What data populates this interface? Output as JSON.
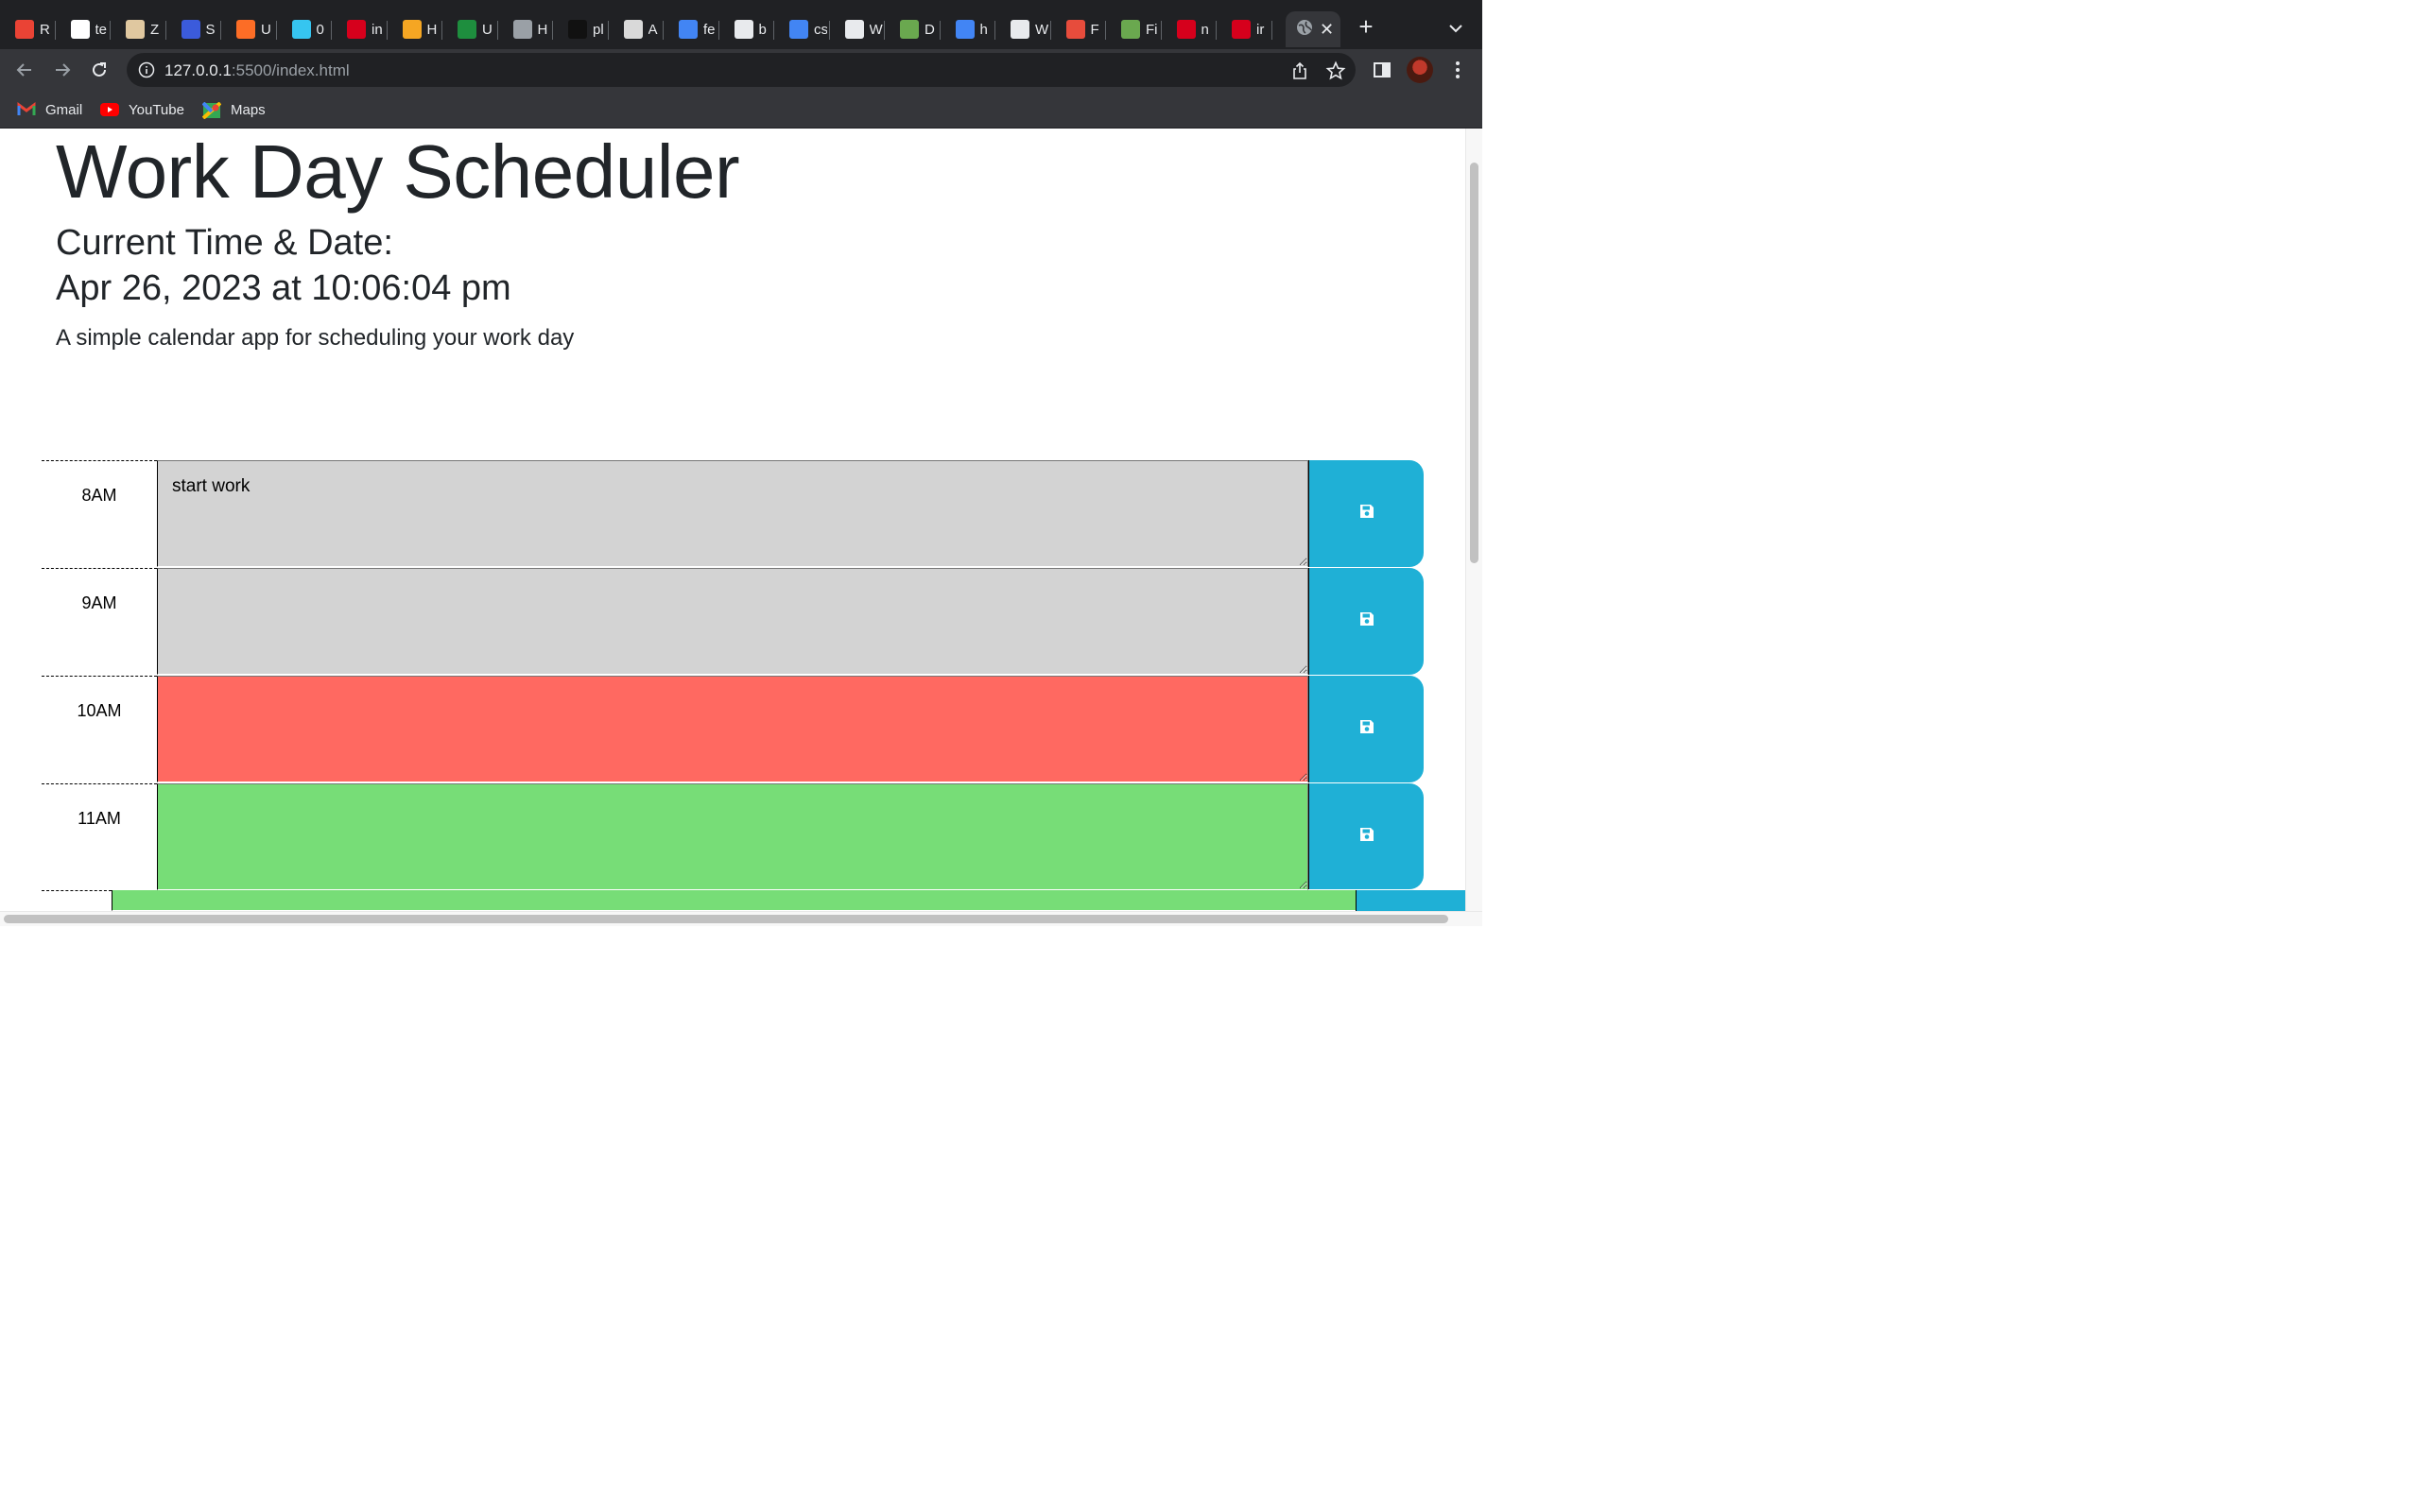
{
  "browser": {
    "tabs": [
      {
        "icon": "gmail-icon",
        "title": "R",
        "color": "#ea4335"
      },
      {
        "icon": "github-icon",
        "title": "te",
        "color": "#ffffff"
      },
      {
        "icon": "zoom-icon",
        "title": "Z",
        "color": "#e0c8a0"
      },
      {
        "icon": "rocket-icon",
        "title": "S",
        "color": "#3b5bdb"
      },
      {
        "icon": "gitlab-icon",
        "title": "U",
        "color": "#fc6d26"
      },
      {
        "icon": "slack-icon",
        "title": "0",
        "color": "#36c5f0"
      },
      {
        "icon": "n-icon",
        "title": "in",
        "color": "#d6001c"
      },
      {
        "icon": "fs-icon",
        "title": "H",
        "color": "#f5a623"
      },
      {
        "icon": "plus-green-icon",
        "title": "U",
        "color": "#1e8e3e"
      },
      {
        "icon": "s-letter-icon",
        "title": "H",
        "color": "#9aa0a6"
      },
      {
        "icon": "block-icon",
        "title": "pl",
        "color": "#111111"
      },
      {
        "icon": "bird-icon",
        "title": "A",
        "color": "#d9d9d9"
      },
      {
        "icon": "google-icon",
        "title": "fe",
        "color": "#4285f4"
      },
      {
        "icon": "m-letter-icon",
        "title": "b",
        "color": "#e8eaed"
      },
      {
        "icon": "google-icon",
        "title": "cs",
        "color": "#4285f4"
      },
      {
        "icon": "globe-icon",
        "title": "W",
        "color": "#e8eaed"
      },
      {
        "icon": "cube-icon",
        "title": "D",
        "color": "#6aa84f"
      },
      {
        "icon": "google-icon",
        "title": "h",
        "color": "#4285f4"
      },
      {
        "icon": "globe-icon",
        "title": "W",
        "color": "#e8eaed"
      },
      {
        "icon": "day-icon",
        "title": "F",
        "color": "#e74c3c"
      },
      {
        "icon": "cube-icon",
        "title": "Fi",
        "color": "#6aa84f"
      },
      {
        "icon": "n-icon",
        "title": "n",
        "color": "#d6001c"
      },
      {
        "icon": "n-icon",
        "title": "ir",
        "color": "#d6001c"
      }
    ],
    "active_tab_icon": "globe-icon",
    "url_host": "127.0.0.1",
    "url_path": ":5500/index.html",
    "bookmarks": [
      {
        "label": "Gmail",
        "icon": "gmail-icon"
      },
      {
        "label": "YouTube",
        "icon": "youtube-icon"
      },
      {
        "label": "Maps",
        "icon": "maps-icon"
      }
    ]
  },
  "page": {
    "title": "Work Day Scheduler",
    "current_label": "Current Time & Date:",
    "current_value": "Apr 26, 2023 at 10:06:04 pm",
    "lead": "A simple calendar app for scheduling your work day"
  },
  "schedule": {
    "rows": [
      {
        "hour": "8AM",
        "text": "start work",
        "state": "past"
      },
      {
        "hour": "9AM",
        "text": "",
        "state": "past"
      },
      {
        "hour": "10AM",
        "text": "",
        "state": "present"
      },
      {
        "hour": "11AM",
        "text": "",
        "state": "future"
      }
    ],
    "save_icon": "save-icon"
  },
  "colors": {
    "past": "#d3d3d3",
    "present": "#ff6961",
    "future": "#77dd77",
    "save": "#1fb0d6"
  }
}
